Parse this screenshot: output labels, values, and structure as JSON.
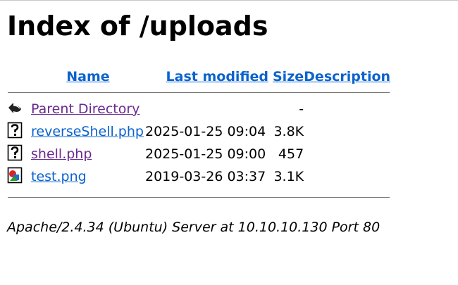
{
  "page": {
    "title": "Index of /uploads"
  },
  "columns": {
    "name": "Name",
    "last_modified": "Last modified",
    "size": "Size",
    "description": "Description"
  },
  "rows": [
    {
      "icon": "back-arrow-icon",
      "name": "Parent Directory",
      "date": "",
      "size": "-",
      "description": ""
    },
    {
      "icon": "unknown-file-icon",
      "name": "reverseShell.php",
      "date": "2025-01-25 09:04",
      "size": "3.8K",
      "description": ""
    },
    {
      "icon": "unknown-file-icon",
      "name": "shell.php",
      "date": "2025-01-25 09:00",
      "size": "457",
      "description": ""
    },
    {
      "icon": "image-file-icon",
      "name": "test.png",
      "date": "2019-03-26 03:37",
      "size": "3.1K",
      "description": ""
    }
  ],
  "footer": {
    "server": "Apache/2.4.34 (Ubuntu) Server at 10.10.10.130 Port 80"
  },
  "colors": {
    "link": "#0b63ce",
    "visited_link": "#6a2990"
  }
}
